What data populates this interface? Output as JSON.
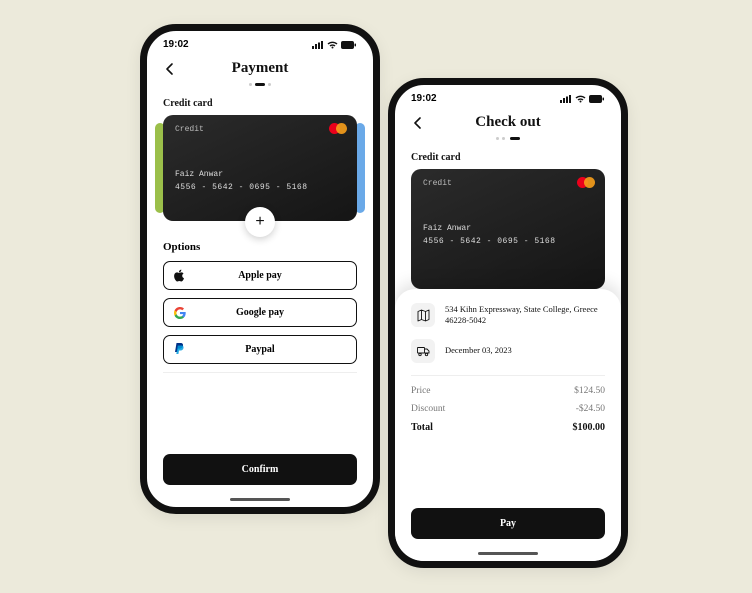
{
  "status": {
    "time": "19:02"
  },
  "payment": {
    "title": "Payment",
    "section": "Credit card",
    "card": {
      "label": "Credit",
      "name": "Faiz Anwar",
      "number": "4556 - 5642 - 0695 - 5168"
    },
    "options_title": "Options",
    "options": {
      "apple": "Apple pay",
      "google": "Google pay",
      "paypal": "Paypal"
    },
    "confirm": "Confirm"
  },
  "checkout": {
    "title": "Check out",
    "section": "Credit card",
    "card": {
      "label": "Credit",
      "name": "Faiz Anwar",
      "number": "4556 - 5642 - 0695 - 5168"
    },
    "address": "534 Kihn Expressway, State College, Greece 46228-5042",
    "date": "December 03, 2023",
    "rows": {
      "price_label": "Price",
      "price_value": "$124.50",
      "discount_label": "Discount",
      "discount_value": "-$24.50",
      "total_label": "Total",
      "total_value": "$100.00"
    },
    "pay": "Pay"
  }
}
